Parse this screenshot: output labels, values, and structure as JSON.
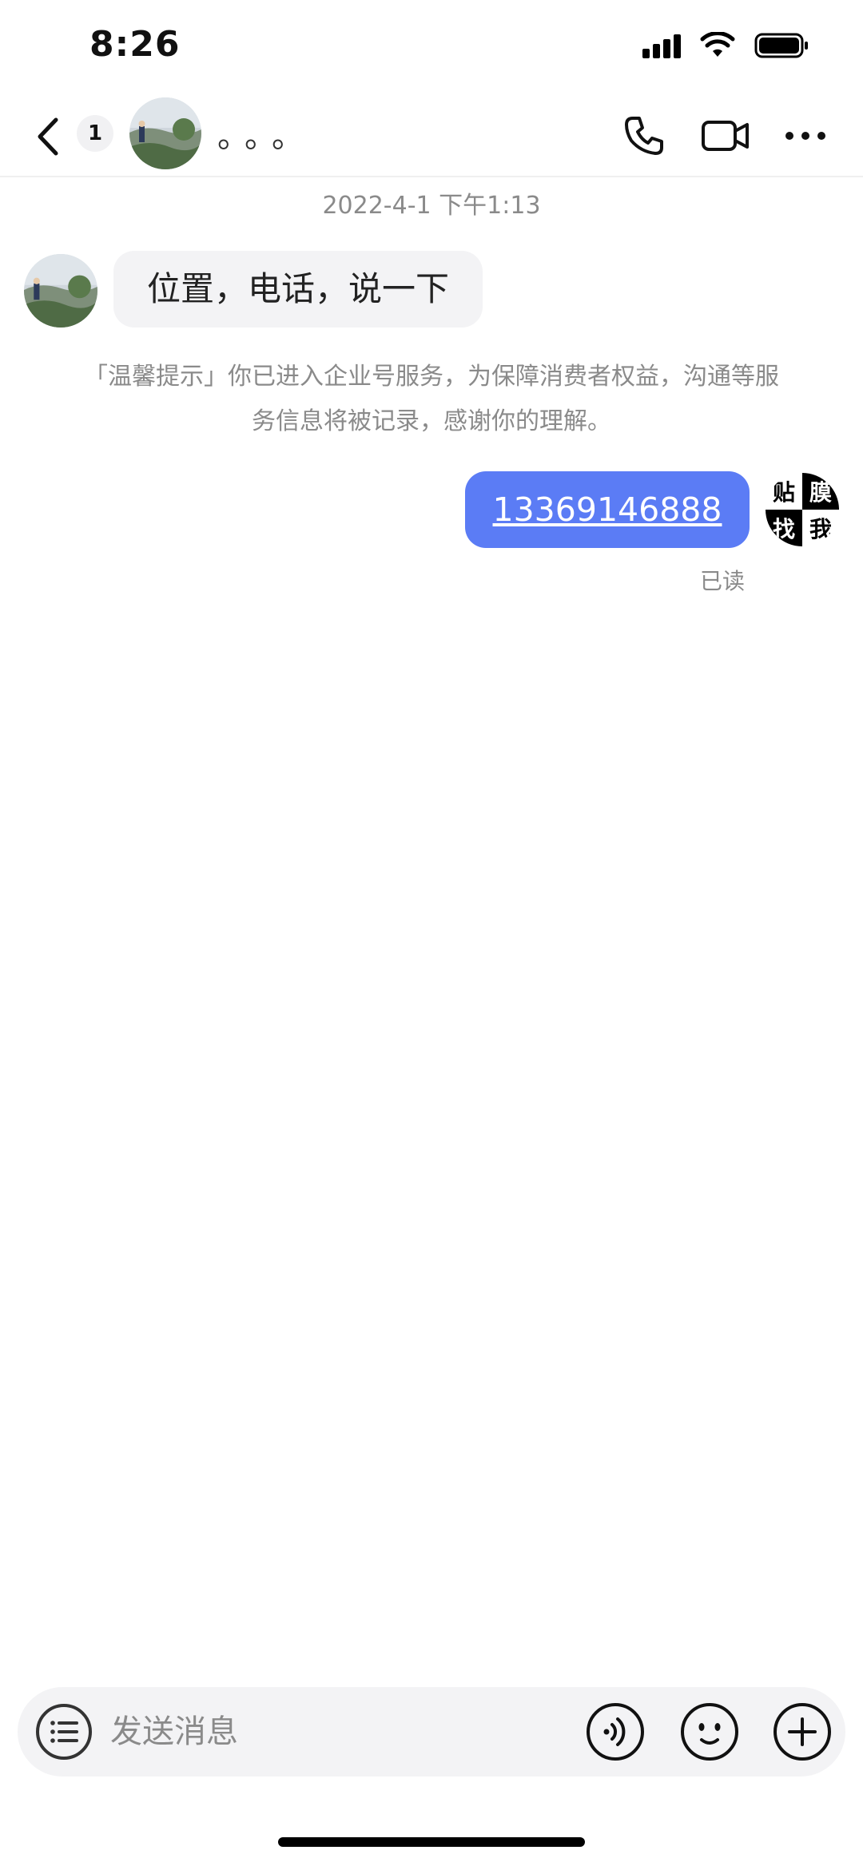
{
  "status_bar": {
    "time": "8:26",
    "icons": [
      "signal-icon",
      "wifi-icon",
      "battery-icon"
    ]
  },
  "header": {
    "back_icon": "chevron-left-icon",
    "unread_count": "1",
    "contact_name": "。。。",
    "actions": [
      "phone-icon",
      "video-camera-icon",
      "more-icon"
    ]
  },
  "chat": {
    "timestamp": "2022-4-1 下午1:13",
    "incoming_message": "位置，电话，说一下",
    "system_notice": "「温馨提示」你已进入企业号服务，为保障消费者权益，沟通等服务信息将被记录，感谢你的理解。",
    "outgoing_message": "13369146888",
    "read_status": "已读",
    "outgoing_avatar_text": [
      "贴",
      "膜",
      "找",
      "我"
    ]
  },
  "input_bar": {
    "placeholder": "发送消息",
    "icons": [
      "menu-icon",
      "voice-icon",
      "emoji-icon",
      "plus-icon"
    ]
  },
  "colors": {
    "accent": "#5b7cf5",
    "bubble_incoming": "#f3f3f5",
    "muted_text": "#8a8a8a"
  }
}
